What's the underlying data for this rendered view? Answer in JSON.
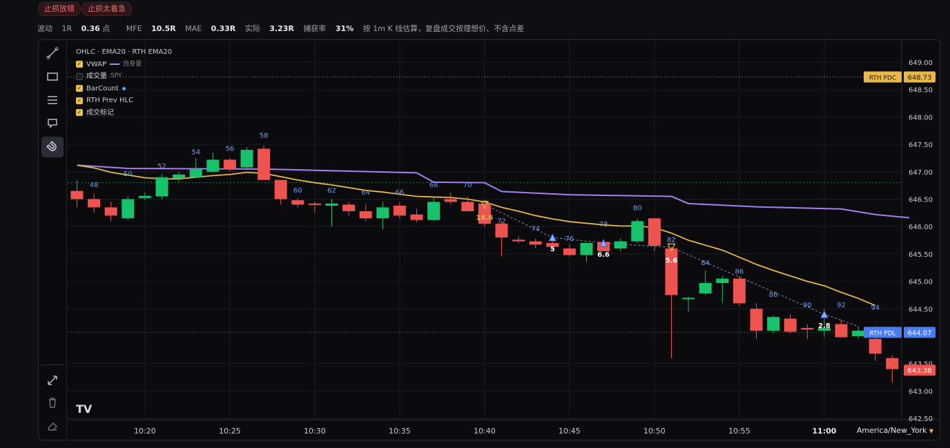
{
  "tags": [
    "止损放错",
    "止损太着急"
  ],
  "stats": [
    {
      "label": "波动",
      "value": ""
    },
    {
      "label": "1R",
      "value": "0.36",
      "unit": "点"
    },
    {
      "label": "MFE",
      "value": "10.5R",
      "unit": ""
    },
    {
      "label": "MAE",
      "value": "0.33R",
      "unit": ""
    },
    {
      "label": "实际",
      "value": "3.23R",
      "unit": ""
    },
    {
      "label": "捕获率",
      "value": "31%",
      "unit": ""
    }
  ],
  "stats_note": "按 1m K 线估算，复盘成交按理想价、不含点差",
  "legend": {
    "title": "OHLC · EMA20 · RTH EMA20",
    "vwap": "VWAP",
    "vwap_sub": "自身量",
    "volume": "成交量",
    "volume_sub": "SPY",
    "barcount": "BarCount",
    "rth_prev": "RTH Prev HLC",
    "trades": "成交标记"
  },
  "timezone": "America/New_York",
  "colors": {
    "up": "#16c26a",
    "down": "#ef5350",
    "ema": "#e8b84a",
    "vwap": "#a77ff0",
    "pdc": "#e8b84a",
    "pdl": "#4c7df0",
    "last": "#ef5350"
  },
  "chart_data": {
    "type": "candlestick",
    "ylim": [
      642.5,
      649.0
    ],
    "yticks": [
      "649.00",
      "648.50",
      "648.00",
      "647.50",
      "647.00",
      "646.50",
      "646.00",
      "645.50",
      "645.00",
      "644.50",
      "643.50",
      "643.00",
      "642.50"
    ],
    "xticks": [
      {
        "t": "10:20",
        "bar": 4
      },
      {
        "t": "10:25",
        "bar": 9
      },
      {
        "t": "10:30",
        "bar": 14
      },
      {
        "t": "10:35",
        "bar": 19
      },
      {
        "t": "10:40",
        "bar": 24
      },
      {
        "t": "10:45",
        "bar": 29
      },
      {
        "t": "10:50",
        "bar": 34
      },
      {
        "t": "10:55",
        "bar": 39
      },
      {
        "t": "11:00",
        "bar": 44
      }
    ],
    "first_bar_time": "10:16",
    "candles": [
      [
        646.65,
        646.85,
        646.35,
        646.5
      ],
      [
        646.5,
        646.6,
        646.25,
        646.35
      ],
      [
        646.35,
        646.45,
        646.1,
        646.2
      ],
      [
        646.15,
        646.55,
        646.12,
        646.5
      ],
      [
        646.52,
        646.62,
        646.48,
        646.56
      ],
      [
        646.55,
        646.95,
        646.5,
        646.9
      ],
      [
        646.88,
        647.0,
        646.82,
        646.95
      ],
      [
        646.9,
        647.25,
        646.88,
        647.05
      ],
      [
        647.0,
        647.35,
        646.98,
        647.22
      ],
      [
        647.22,
        647.25,
        647.0,
        647.05
      ],
      [
        647.08,
        647.45,
        647.05,
        647.4
      ],
      [
        647.42,
        647.48,
        646.85,
        646.85
      ],
      [
        646.85,
        646.85,
        646.4,
        646.5
      ],
      [
        646.48,
        646.52,
        646.35,
        646.4
      ],
      [
        646.42,
        646.45,
        646.25,
        646.4
      ],
      [
        646.38,
        646.5,
        646.0,
        646.42
      ],
      [
        646.4,
        646.45,
        646.2,
        646.28
      ],
      [
        646.28,
        646.4,
        646.1,
        646.15
      ],
      [
        646.15,
        646.45,
        645.95,
        646.35
      ],
      [
        646.38,
        646.45,
        646.15,
        646.2
      ],
      [
        646.22,
        646.32,
        646.08,
        646.12
      ],
      [
        646.12,
        646.55,
        646.1,
        646.45
      ],
      [
        646.5,
        646.62,
        646.4,
        646.45
      ],
      [
        646.45,
        646.55,
        646.28,
        646.28
      ],
      [
        646.42,
        646.48,
        646.0,
        646.05
      ],
      [
        646.05,
        646.1,
        645.45,
        645.8
      ],
      [
        645.76,
        645.82,
        645.7,
        645.73
      ],
      [
        645.73,
        645.78,
        645.6,
        645.67
      ],
      [
        645.7,
        645.85,
        645.58,
        645.63
      ],
      [
        645.6,
        645.68,
        645.45,
        645.48
      ],
      [
        645.48,
        645.7,
        645.35,
        645.7
      ],
      [
        645.72,
        645.78,
        645.55,
        645.55
      ],
      [
        645.6,
        645.78,
        645.55,
        645.73
      ],
      [
        645.73,
        646.15,
        645.7,
        646.1
      ],
      [
        646.15,
        646.15,
        645.55,
        645.65
      ],
      [
        645.6,
        645.62,
        643.6,
        644.75
      ],
      [
        644.7,
        644.72,
        644.45,
        644.7
      ],
      [
        644.78,
        645.2,
        644.75,
        644.97
      ],
      [
        644.97,
        645.1,
        644.6,
        645.05
      ],
      [
        645.05,
        645.1,
        644.55,
        644.6
      ],
      [
        644.5,
        644.6,
        643.95,
        644.1
      ],
      [
        644.1,
        644.38,
        644.05,
        644.35
      ],
      [
        644.32,
        644.4,
        644.05,
        644.08
      ],
      [
        644.15,
        644.22,
        643.95,
        644.12
      ],
      [
        644.1,
        644.5,
        643.98,
        644.15
      ],
      [
        644.22,
        644.3,
        643.98,
        643.98
      ],
      [
        644.0,
        644.18,
        643.95,
        644.1
      ],
      [
        643.95,
        644.18,
        643.55,
        643.68
      ],
      [
        643.6,
        643.65,
        643.15,
        643.4
      ]
    ],
    "ema": [
      647.12,
      647.07,
      646.99,
      646.94,
      646.89,
      646.87,
      646.87,
      646.9,
      646.93,
      646.95,
      646.99,
      646.97,
      646.91,
      646.85,
      646.8,
      646.76,
      646.71,
      646.66,
      646.63,
      646.59,
      646.55,
      646.54,
      646.53,
      646.5,
      646.45,
      646.35,
      646.28,
      646.2,
      646.14,
      646.09,
      646.06,
      646.03,
      646.01,
      646.01,
      645.98,
      645.88,
      645.75,
      645.66,
      645.57,
      645.44,
      645.31,
      645.2,
      645.1,
      645.0,
      644.92,
      644.8,
      644.69,
      644.56
    ],
    "vwap": [
      [
        0,
        647.12
      ],
      [
        3,
        647.06
      ],
      [
        11,
        647.05
      ],
      [
        20,
        646.98
      ],
      [
        21,
        646.81
      ],
      [
        24,
        646.8
      ],
      [
        25,
        646.64
      ],
      [
        29,
        646.58
      ],
      [
        35,
        646.55
      ],
      [
        36,
        646.42
      ],
      [
        40,
        646.36
      ],
      [
        45,
        646.32
      ],
      [
        47,
        646.22
      ],
      [
        49,
        646.16
      ]
    ],
    "bar_counts": [
      {
        "bar": 1,
        "n": "48",
        "y": 646.72
      },
      {
        "bar": 3,
        "n": "50",
        "y": 646.92
      },
      {
        "bar": 5,
        "n": "52",
        "y": 647.06
      },
      {
        "bar": 7,
        "n": "54",
        "y": 647.32
      },
      {
        "bar": 9,
        "n": "56",
        "y": 647.38
      },
      {
        "bar": 11,
        "n": "58",
        "y": 647.62
      },
      {
        "bar": 13,
        "n": "60",
        "y": 646.62
      },
      {
        "bar": 15,
        "n": "62",
        "y": 646.62
      },
      {
        "bar": 17,
        "n": "64",
        "y": 646.58
      },
      {
        "bar": 19,
        "n": "66",
        "y": 646.58
      },
      {
        "bar": 21,
        "n": "68",
        "y": 646.72
      },
      {
        "bar": 23,
        "n": "70",
        "y": 646.72
      },
      {
        "bar": 25,
        "n": "72",
        "y": 646.06
      },
      {
        "bar": 27,
        "n": "74",
        "y": 645.92
      },
      {
        "bar": 29,
        "n": "76",
        "y": 645.74
      },
      {
        "bar": 31,
        "n": "78",
        "y": 646.0
      },
      {
        "bar": 33,
        "n": "80",
        "y": 646.3
      },
      {
        "bar": 35,
        "n": "82",
        "y": 645.72
      },
      {
        "bar": 37,
        "n": "84",
        "y": 645.3
      },
      {
        "bar": 39,
        "n": "86",
        "y": 645.14
      },
      {
        "bar": 41,
        "n": "88",
        "y": 644.72
      },
      {
        "bar": 43,
        "n": "90",
        "y": 644.53
      },
      {
        "bar": 45,
        "n": "92",
        "y": 644.53
      },
      {
        "bar": 47,
        "n": "94",
        "y": 644.48
      }
    ],
    "trades": [
      {
        "bar": 24,
        "dir": "short",
        "y": 646.4,
        "label": "16.6"
      },
      {
        "bar": 28,
        "dir": "long",
        "y": 645.8,
        "label": "5"
      },
      {
        "bar": 31,
        "dir": "long",
        "y": 645.7,
        "label": "6.6"
      },
      {
        "bar": 35,
        "dir": "short",
        "y": 645.62,
        "label": "5.6"
      },
      {
        "bar": 44,
        "dir": "long",
        "y": 644.4,
        "label": "2.8"
      }
    ],
    "trade_line": [
      [
        24,
        646.4
      ],
      [
        28,
        645.8
      ],
      [
        31,
        645.7
      ],
      [
        35,
        645.62
      ],
      [
        44,
        644.4
      ],
      [
        46,
        644.18
      ]
    ],
    "levels": [
      {
        "name": "RTH PDC",
        "value": "648.73",
        "y": 648.73,
        "color": "#e8b84a",
        "text": "#1a1a1a"
      },
      {
        "name": "RTH PDL",
        "value": "644.07",
        "y": 644.07,
        "color": "#4c7df0",
        "text": "#ffffff"
      }
    ],
    "green_dotted_level": 646.8,
    "last_price": {
      "value": "643.38",
      "y": 643.38
    }
  }
}
